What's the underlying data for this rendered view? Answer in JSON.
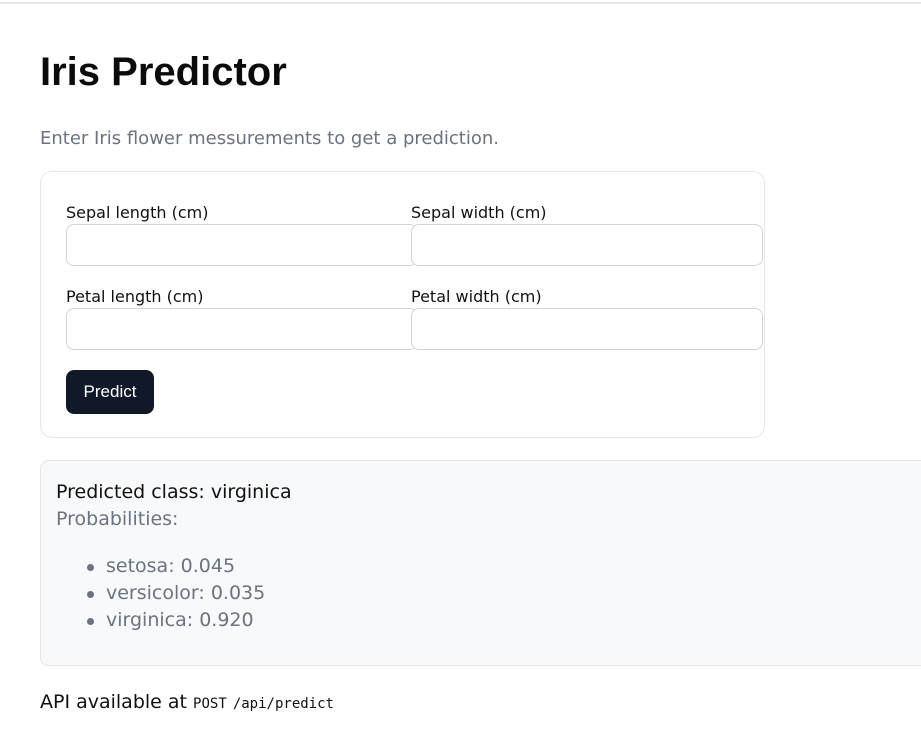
{
  "page": {
    "title": "Iris Predictor",
    "subtitle": "Enter Iris flower messurements to get a prediction."
  },
  "form": {
    "fields": [
      {
        "label": "Sepal length (cm)",
        "value": "",
        "placeholder": ""
      },
      {
        "label": "Sepal width (cm)",
        "value": "",
        "placeholder": ""
      },
      {
        "label": "Petal length (cm)",
        "value": "",
        "placeholder": ""
      },
      {
        "label": "Petal width (cm)",
        "value": "",
        "placeholder": ""
      }
    ],
    "submit_label": "Predict"
  },
  "result": {
    "predicted_class_text": "Predicted class: virginica",
    "probabilities_title": "Probabilities:",
    "probabilities": [
      {
        "text": "setosa: 0.045"
      },
      {
        "text": "versicolor: 0.035"
      },
      {
        "text": "virginica: 0.920"
      }
    ]
  },
  "footer": {
    "api_prefix": "API available at",
    "api_method": "POST",
    "api_path": "/api/predict"
  },
  "colors": {
    "button_bg": "#111827",
    "muted_text": "#6b7280",
    "border": "#e5e7eb",
    "result_bg": "#f8f9fa"
  }
}
